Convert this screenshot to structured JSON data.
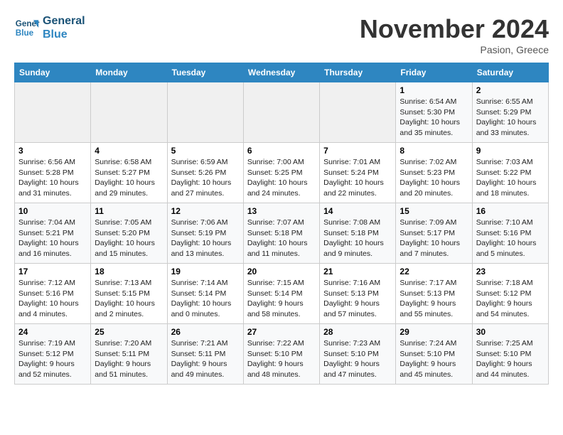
{
  "logo": {
    "line1": "General",
    "line2": "Blue"
  },
  "title": "November 2024",
  "location": "Pasion, Greece",
  "days_of_week": [
    "Sunday",
    "Monday",
    "Tuesday",
    "Wednesday",
    "Thursday",
    "Friday",
    "Saturday"
  ],
  "weeks": [
    [
      {
        "day": "",
        "info": ""
      },
      {
        "day": "",
        "info": ""
      },
      {
        "day": "",
        "info": ""
      },
      {
        "day": "",
        "info": ""
      },
      {
        "day": "",
        "info": ""
      },
      {
        "day": "1",
        "info": "Sunrise: 6:54 AM\nSunset: 5:30 PM\nDaylight: 10 hours and 35 minutes."
      },
      {
        "day": "2",
        "info": "Sunrise: 6:55 AM\nSunset: 5:29 PM\nDaylight: 10 hours and 33 minutes."
      }
    ],
    [
      {
        "day": "3",
        "info": "Sunrise: 6:56 AM\nSunset: 5:28 PM\nDaylight: 10 hours and 31 minutes."
      },
      {
        "day": "4",
        "info": "Sunrise: 6:58 AM\nSunset: 5:27 PM\nDaylight: 10 hours and 29 minutes."
      },
      {
        "day": "5",
        "info": "Sunrise: 6:59 AM\nSunset: 5:26 PM\nDaylight: 10 hours and 27 minutes."
      },
      {
        "day": "6",
        "info": "Sunrise: 7:00 AM\nSunset: 5:25 PM\nDaylight: 10 hours and 24 minutes."
      },
      {
        "day": "7",
        "info": "Sunrise: 7:01 AM\nSunset: 5:24 PM\nDaylight: 10 hours and 22 minutes."
      },
      {
        "day": "8",
        "info": "Sunrise: 7:02 AM\nSunset: 5:23 PM\nDaylight: 10 hours and 20 minutes."
      },
      {
        "day": "9",
        "info": "Sunrise: 7:03 AM\nSunset: 5:22 PM\nDaylight: 10 hours and 18 minutes."
      }
    ],
    [
      {
        "day": "10",
        "info": "Sunrise: 7:04 AM\nSunset: 5:21 PM\nDaylight: 10 hours and 16 minutes."
      },
      {
        "day": "11",
        "info": "Sunrise: 7:05 AM\nSunset: 5:20 PM\nDaylight: 10 hours and 15 minutes."
      },
      {
        "day": "12",
        "info": "Sunrise: 7:06 AM\nSunset: 5:19 PM\nDaylight: 10 hours and 13 minutes."
      },
      {
        "day": "13",
        "info": "Sunrise: 7:07 AM\nSunset: 5:18 PM\nDaylight: 10 hours and 11 minutes."
      },
      {
        "day": "14",
        "info": "Sunrise: 7:08 AM\nSunset: 5:18 PM\nDaylight: 10 hours and 9 minutes."
      },
      {
        "day": "15",
        "info": "Sunrise: 7:09 AM\nSunset: 5:17 PM\nDaylight: 10 hours and 7 minutes."
      },
      {
        "day": "16",
        "info": "Sunrise: 7:10 AM\nSunset: 5:16 PM\nDaylight: 10 hours and 5 minutes."
      }
    ],
    [
      {
        "day": "17",
        "info": "Sunrise: 7:12 AM\nSunset: 5:16 PM\nDaylight: 10 hours and 4 minutes."
      },
      {
        "day": "18",
        "info": "Sunrise: 7:13 AM\nSunset: 5:15 PM\nDaylight: 10 hours and 2 minutes."
      },
      {
        "day": "19",
        "info": "Sunrise: 7:14 AM\nSunset: 5:14 PM\nDaylight: 10 hours and 0 minutes."
      },
      {
        "day": "20",
        "info": "Sunrise: 7:15 AM\nSunset: 5:14 PM\nDaylight: 9 hours and 58 minutes."
      },
      {
        "day": "21",
        "info": "Sunrise: 7:16 AM\nSunset: 5:13 PM\nDaylight: 9 hours and 57 minutes."
      },
      {
        "day": "22",
        "info": "Sunrise: 7:17 AM\nSunset: 5:13 PM\nDaylight: 9 hours and 55 minutes."
      },
      {
        "day": "23",
        "info": "Sunrise: 7:18 AM\nSunset: 5:12 PM\nDaylight: 9 hours and 54 minutes."
      }
    ],
    [
      {
        "day": "24",
        "info": "Sunrise: 7:19 AM\nSunset: 5:12 PM\nDaylight: 9 hours and 52 minutes."
      },
      {
        "day": "25",
        "info": "Sunrise: 7:20 AM\nSunset: 5:11 PM\nDaylight: 9 hours and 51 minutes."
      },
      {
        "day": "26",
        "info": "Sunrise: 7:21 AM\nSunset: 5:11 PM\nDaylight: 9 hours and 49 minutes."
      },
      {
        "day": "27",
        "info": "Sunrise: 7:22 AM\nSunset: 5:10 PM\nDaylight: 9 hours and 48 minutes."
      },
      {
        "day": "28",
        "info": "Sunrise: 7:23 AM\nSunset: 5:10 PM\nDaylight: 9 hours and 47 minutes."
      },
      {
        "day": "29",
        "info": "Sunrise: 7:24 AM\nSunset: 5:10 PM\nDaylight: 9 hours and 45 minutes."
      },
      {
        "day": "30",
        "info": "Sunrise: 7:25 AM\nSunset: 5:10 PM\nDaylight: 9 hours and 44 minutes."
      }
    ]
  ]
}
